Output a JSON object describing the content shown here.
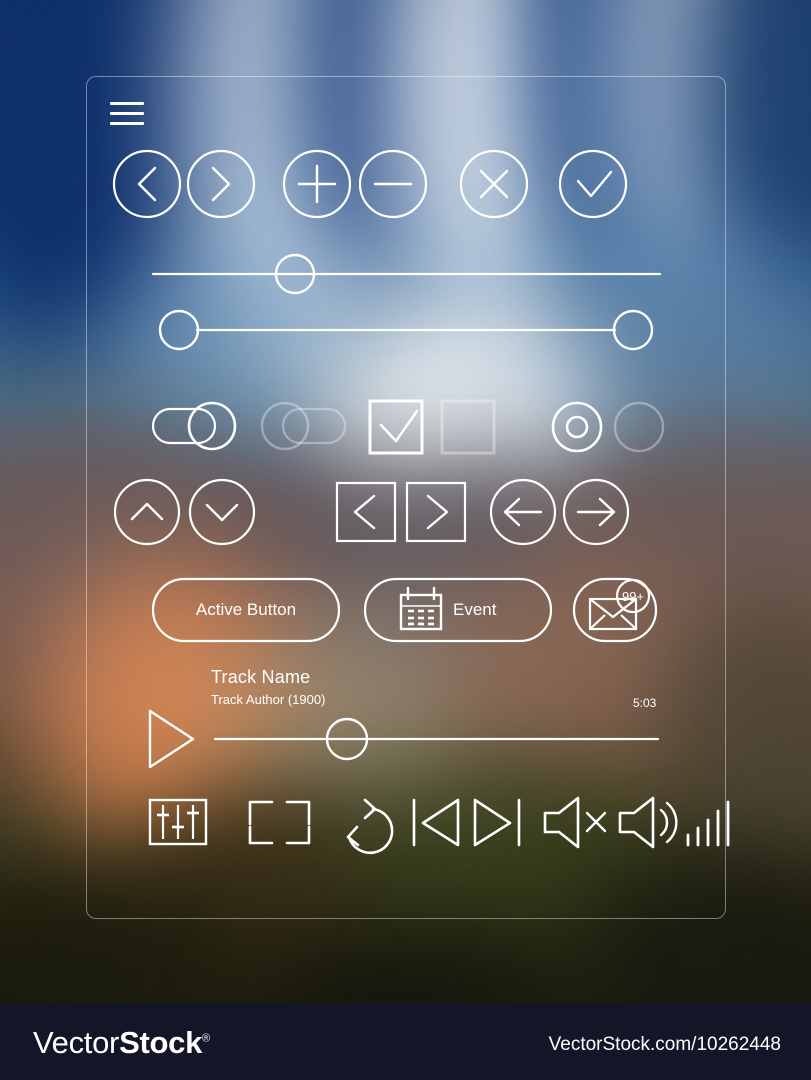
{
  "panel": {
    "menu_icon": "hamburger-menu-icon"
  },
  "icon_buttons_row": [
    {
      "name": "prev-chevron-circle-button",
      "icon": "chevron-left-icon",
      "state": "enabled"
    },
    {
      "name": "next-chevron-circle-button",
      "icon": "chevron-right-icon",
      "state": "enabled"
    },
    {
      "name": "plus-circle-button",
      "icon": "plus-icon",
      "state": "enabled"
    },
    {
      "name": "minus-circle-button",
      "icon": "minus-icon",
      "state": "enabled"
    },
    {
      "name": "close-circle-button",
      "icon": "close-x-icon",
      "state": "enabled"
    },
    {
      "name": "confirm-circle-button",
      "icon": "check-icon",
      "state": "enabled"
    }
  ],
  "sliders": {
    "single": {
      "name": "volume-slider",
      "value_percent": 28
    },
    "range": {
      "name": "range-slider",
      "low_percent": 0,
      "high_percent": 100
    }
  },
  "toggles": [
    {
      "name": "toggle-switch-on",
      "state": "on",
      "label": ""
    },
    {
      "name": "toggle-switch-off",
      "state": "off",
      "label": ""
    }
  ],
  "checkboxes": [
    {
      "name": "checkbox-checked",
      "state": "checked"
    },
    {
      "name": "checkbox-unchecked",
      "state": "unchecked"
    }
  ],
  "radios": [
    {
      "name": "radio-selected",
      "state": "selected"
    },
    {
      "name": "radio-unselected",
      "state": "unselected"
    }
  ],
  "nav_row": [
    {
      "name": "scroll-up-circle-button",
      "icon": "chevron-up-icon"
    },
    {
      "name": "scroll-down-circle-button",
      "icon": "chevron-down-icon"
    },
    {
      "name": "page-prev-square-button",
      "icon": "chevron-left-icon"
    },
    {
      "name": "page-next-square-button",
      "icon": "chevron-right-icon"
    },
    {
      "name": "back-arrow-circle-button",
      "icon": "arrow-left-icon"
    },
    {
      "name": "forward-arrow-circle-button",
      "icon": "arrow-right-icon"
    }
  ],
  "buttons": {
    "active": {
      "label": "Active Button"
    },
    "event": {
      "label": "Event",
      "icon": "calendar-icon"
    },
    "mail": {
      "badge": "99+",
      "icon": "envelope-icon"
    }
  },
  "player": {
    "track_name": "Track Name",
    "track_author": "Track Author (1900)",
    "duration": "5:03",
    "progress_percent": 28,
    "play_icon": "play-icon"
  },
  "media_controls": [
    {
      "name": "equalizer-button",
      "icon": "equalizer-icon"
    },
    {
      "name": "fullscreen-button",
      "icon": "fullscreen-icon"
    },
    {
      "name": "repeat-button",
      "icon": "repeat-icon"
    },
    {
      "name": "previous-track-button",
      "icon": "previous-track-icon"
    },
    {
      "name": "next-track-button",
      "icon": "next-track-icon"
    },
    {
      "name": "mute-button",
      "icon": "volume-mute-icon"
    },
    {
      "name": "volume-button",
      "icon": "volume-on-icon"
    },
    {
      "name": "signal-strength-indicator",
      "icon": "signal-bars-icon"
    }
  ],
  "footer": {
    "logo_part1": "Vector",
    "logo_part2": "Stock",
    "logo_mark": "®",
    "url": "VectorStock.com/10262448"
  },
  "colors": {
    "stroke": "#ffffff",
    "dim_stroke": "rgba(255,255,255,0.34)",
    "footer_bg": "#141628"
  }
}
